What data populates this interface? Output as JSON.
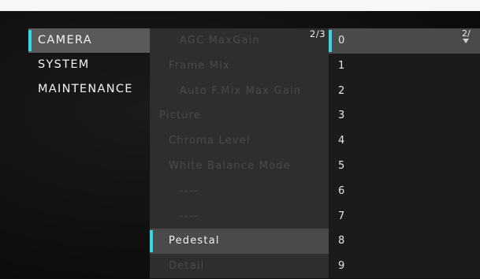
{
  "menu": {
    "categories": [
      {
        "label": "CAMERA",
        "selected": true
      },
      {
        "label": "SYSTEM",
        "selected": false
      },
      {
        "label": "MAINTENANCE",
        "selected": false
      }
    ],
    "settings_page": "2/3",
    "settings": [
      {
        "label": "AGC MaxGain",
        "level": 2,
        "active": false
      },
      {
        "label": "Frame Mix",
        "level": 1,
        "active": false
      },
      {
        "label": "Auto F.Mix Max Gain",
        "level": 2,
        "active": false
      },
      {
        "label": "Picture",
        "level": 0,
        "active": false
      },
      {
        "label": "Chroma Level",
        "level": 1,
        "active": false
      },
      {
        "label": "White Balance Mode",
        "level": 1,
        "active": false
      },
      {
        "label": "----",
        "level": 2,
        "active": false
      },
      {
        "label": "----",
        "level": 2,
        "active": false
      },
      {
        "label": "Pedestal",
        "level": 1,
        "active": true
      },
      {
        "label": "Detail",
        "level": 1,
        "active": false
      }
    ],
    "values_page": "2/",
    "values": [
      {
        "label": "0",
        "selected": true
      },
      {
        "label": "1",
        "selected": false
      },
      {
        "label": "2",
        "selected": false
      },
      {
        "label": "3",
        "selected": false
      },
      {
        "label": "4",
        "selected": false
      },
      {
        "label": "5",
        "selected": false
      },
      {
        "label": "6",
        "selected": false
      },
      {
        "label": "7",
        "selected": false
      },
      {
        "label": "8",
        "selected": false
      },
      {
        "label": "9",
        "selected": false
      }
    ],
    "colors": {
      "accent": "#35d7e0",
      "selected_bg": "#5a5a5a",
      "dim_text": "#4a4a4a"
    }
  }
}
